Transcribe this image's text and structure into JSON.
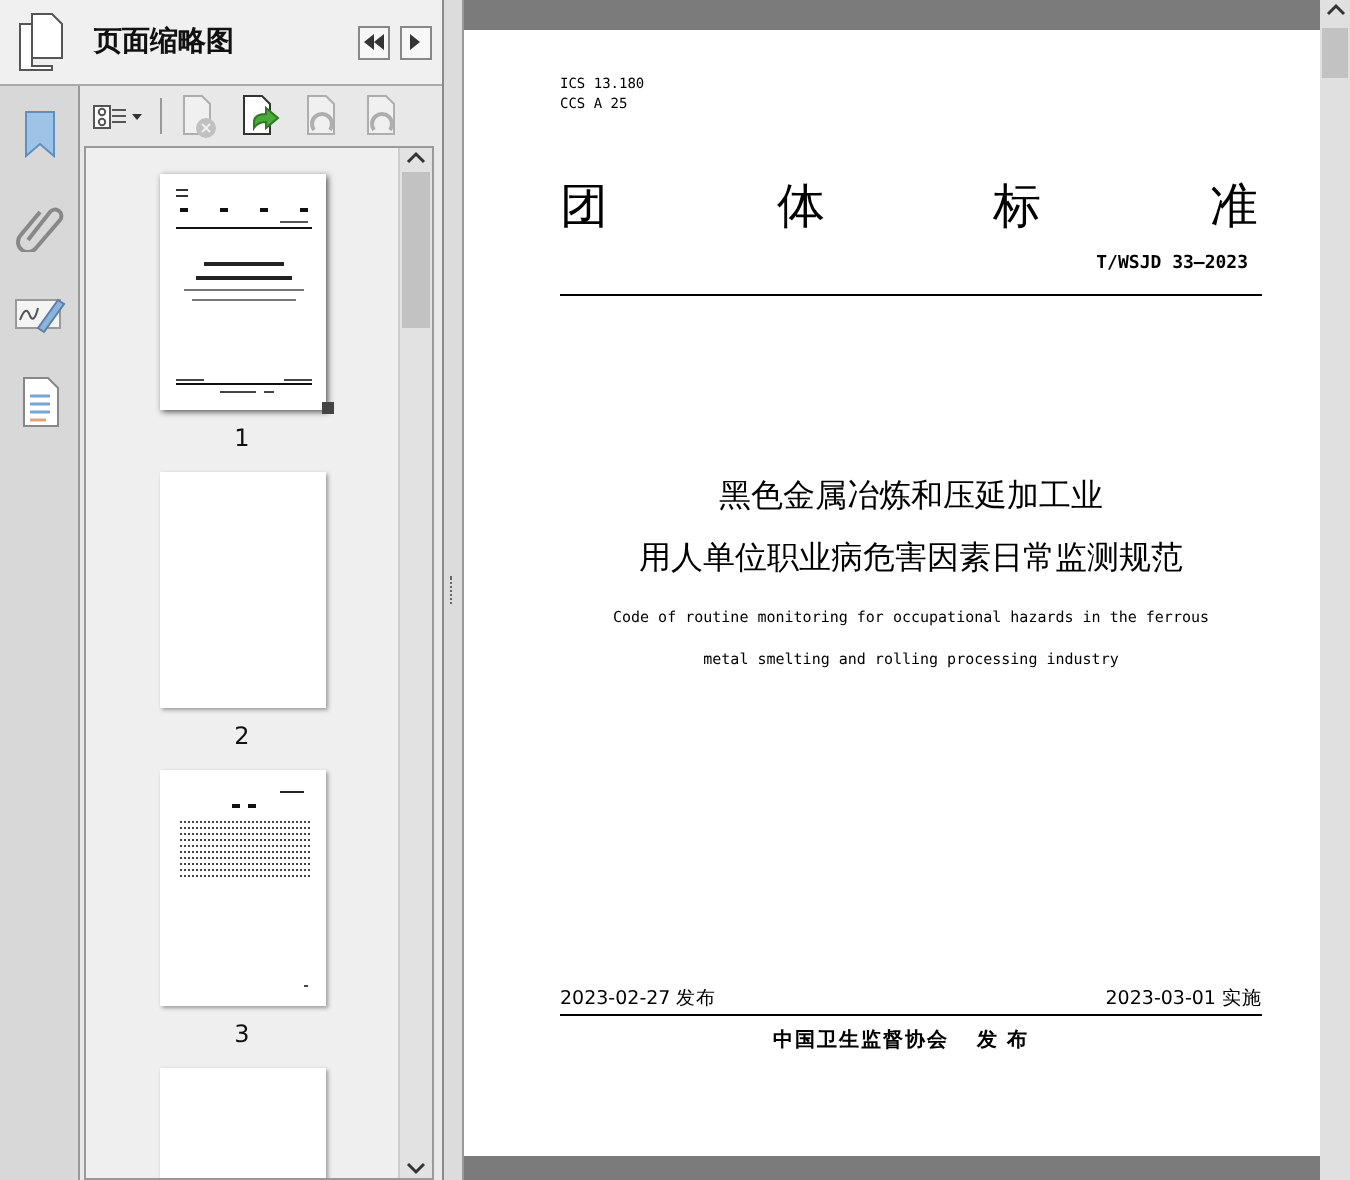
{
  "panel": {
    "title": "页面缩略图",
    "nav_buttons": [
      {
        "kind": "collapse"
      },
      {
        "kind": "expand"
      }
    ]
  },
  "side_tools": [
    {
      "kind": "bookmark"
    },
    {
      "kind": "attachment"
    },
    {
      "kind": "signature"
    },
    {
      "kind": "layers"
    }
  ],
  "toolbar": [
    {
      "kind": "options",
      "disabled": false
    },
    {
      "kind": "delete",
      "disabled": true
    },
    {
      "kind": "insert",
      "disabled": false
    },
    {
      "kind": "rotate-left",
      "disabled": true
    },
    {
      "kind": "rotate-right",
      "disabled": true
    }
  ],
  "thumbnails": [
    {
      "kind": "cover",
      "label": "1",
      "selected": true
    },
    {
      "kind": "blank",
      "label": "2",
      "selected": false
    },
    {
      "kind": "toc",
      "label": "3",
      "selected": false
    },
    {
      "kind": "blank",
      "selected": false
    }
  ],
  "document": {
    "ics": "ICS 13.180",
    "ccs": "CCS A 25",
    "heading": [
      "团",
      "体",
      "标",
      "准"
    ],
    "code": "T/WSJD 33—2023",
    "title_cn": [
      "黑色金属冶炼和压延加工业",
      "用人单位职业病危害因素日常监测规范"
    ],
    "title_en": [
      "Code of routine monitoring for occupational hazards in the ferrous",
      "metal smelting and rolling processing industry"
    ],
    "publish_date": "2023-02-27 发布",
    "effective_date": "2023-03-01 实施",
    "publisher": "中国卫生监督协会",
    "publisher_action": "发 布"
  }
}
